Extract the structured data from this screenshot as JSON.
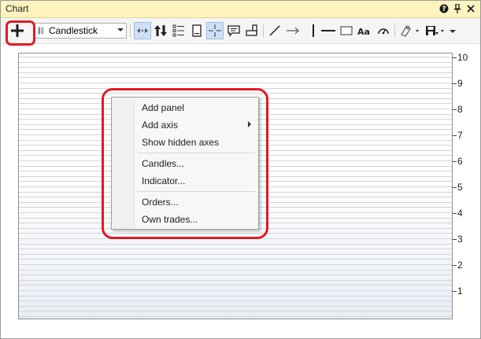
{
  "window": {
    "title": "Chart"
  },
  "titlebar_icons": [
    "help-icon",
    "pin-icon",
    "close-icon"
  ],
  "toolbar": {
    "add_icon": "plus-icon",
    "chart_type_value": "Candlestick",
    "icons": [
      "pan-arrows-icon",
      "sort-icon",
      "list-icon",
      "document-icon",
      "crosshair-icon",
      "comment-icon",
      "rename-icon",
      "trendline-icon",
      "arrow-line-icon",
      "vertical-line-icon",
      "horizontal-line-icon",
      "rectangle-icon",
      "text-icon",
      "gauge-icon",
      "settings-dropdown-icon",
      "save-dropdown-icon",
      "overflow-dropdown-icon"
    ]
  },
  "y_axis": {
    "ticks": [
      "10",
      "9",
      "8",
      "7",
      "6",
      "5",
      "4",
      "3",
      "2",
      "1"
    ]
  },
  "context_menu": {
    "items": [
      {
        "label": "Add panel"
      },
      {
        "label": "Add axis",
        "submenu": true
      },
      {
        "label": "Show hidden axes"
      },
      {
        "label": "Candles..."
      },
      {
        "label": "Indicator..."
      },
      {
        "label": "Orders..."
      },
      {
        "label": "Own trades..."
      }
    ]
  },
  "colors": {
    "highlight": "#e01b24",
    "titlebar": "#fdf4bf",
    "toolbar": "#f5f5f5"
  }
}
